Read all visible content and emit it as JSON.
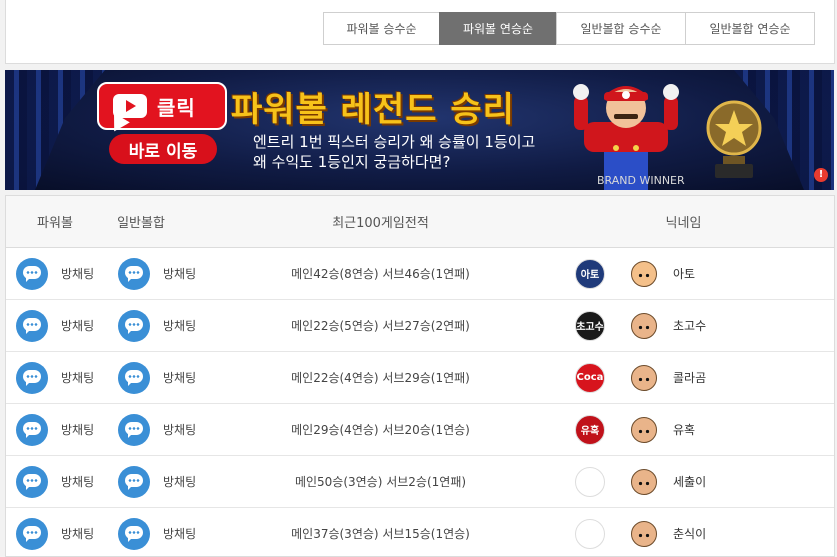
{
  "tabs": [
    {
      "label": "파워볼 승수순",
      "active": false
    },
    {
      "label": "파워볼 연승순",
      "active": true
    },
    {
      "label": "일반볼합 승수순",
      "active": false
    },
    {
      "label": "일반볼합 연승순",
      "active": false
    }
  ],
  "banner": {
    "click_label": "클릭",
    "goto_label": "바로 이동",
    "title": "파워볼 레전드 승리",
    "subtitle_line1": "엔트리 1번 픽스터 승리가 왜 승률이 1등이고",
    "subtitle_line2": "왜 수익도 1등인지 궁금하다면?",
    "brand": "BRAND WINNER",
    "alert": "!"
  },
  "table": {
    "headers": {
      "powerball": "파워볼",
      "normal": "일반볼합",
      "record": "최근100게임전적",
      "nickname": "닉네임"
    },
    "rows": [
      {
        "powerball": "방채팅",
        "normal": "방채팅",
        "record": "메인42승(8연승) 서브46승(1연패)",
        "logo_text": "아토",
        "logo_color": "#1f3a7a",
        "face_color": "#f4c08a",
        "nickname": "아토"
      },
      {
        "powerball": "방채팅",
        "normal": "방채팅",
        "record": "메인22승(5연승) 서브27승(2연패)",
        "logo_text": "초고수",
        "logo_color": "#1a1a1a",
        "face_color": "#e9b48a",
        "nickname": "초고수"
      },
      {
        "powerball": "방채팅",
        "normal": "방채팅",
        "record": "메인22승(4연승) 서브29승(1연패)",
        "logo_text": "Coca",
        "logo_color": "#d7141d",
        "face_color": "#e9b48a",
        "nickname": "콜라곰"
      },
      {
        "powerball": "방채팅",
        "normal": "방채팅",
        "record": "메인29승(4연승) 서브20승(1연승)",
        "logo_text": "유혹",
        "logo_color": "#c0111a",
        "face_color": "#e9b48a",
        "nickname": "유혹"
      },
      {
        "powerball": "방채팅",
        "normal": "방채팅",
        "record": "메인50승(3연승) 서브2승(1연패)",
        "logo_text": "",
        "logo_color": "#ffffff",
        "face_color": "#e9b48a",
        "nickname": "세출이"
      },
      {
        "powerball": "방채팅",
        "normal": "방채팅",
        "record": "메인37승(3연승) 서브15승(1연승)",
        "logo_text": "",
        "logo_color": "#ffffff",
        "face_color": "#e9b48a",
        "nickname": "춘식이"
      }
    ]
  }
}
